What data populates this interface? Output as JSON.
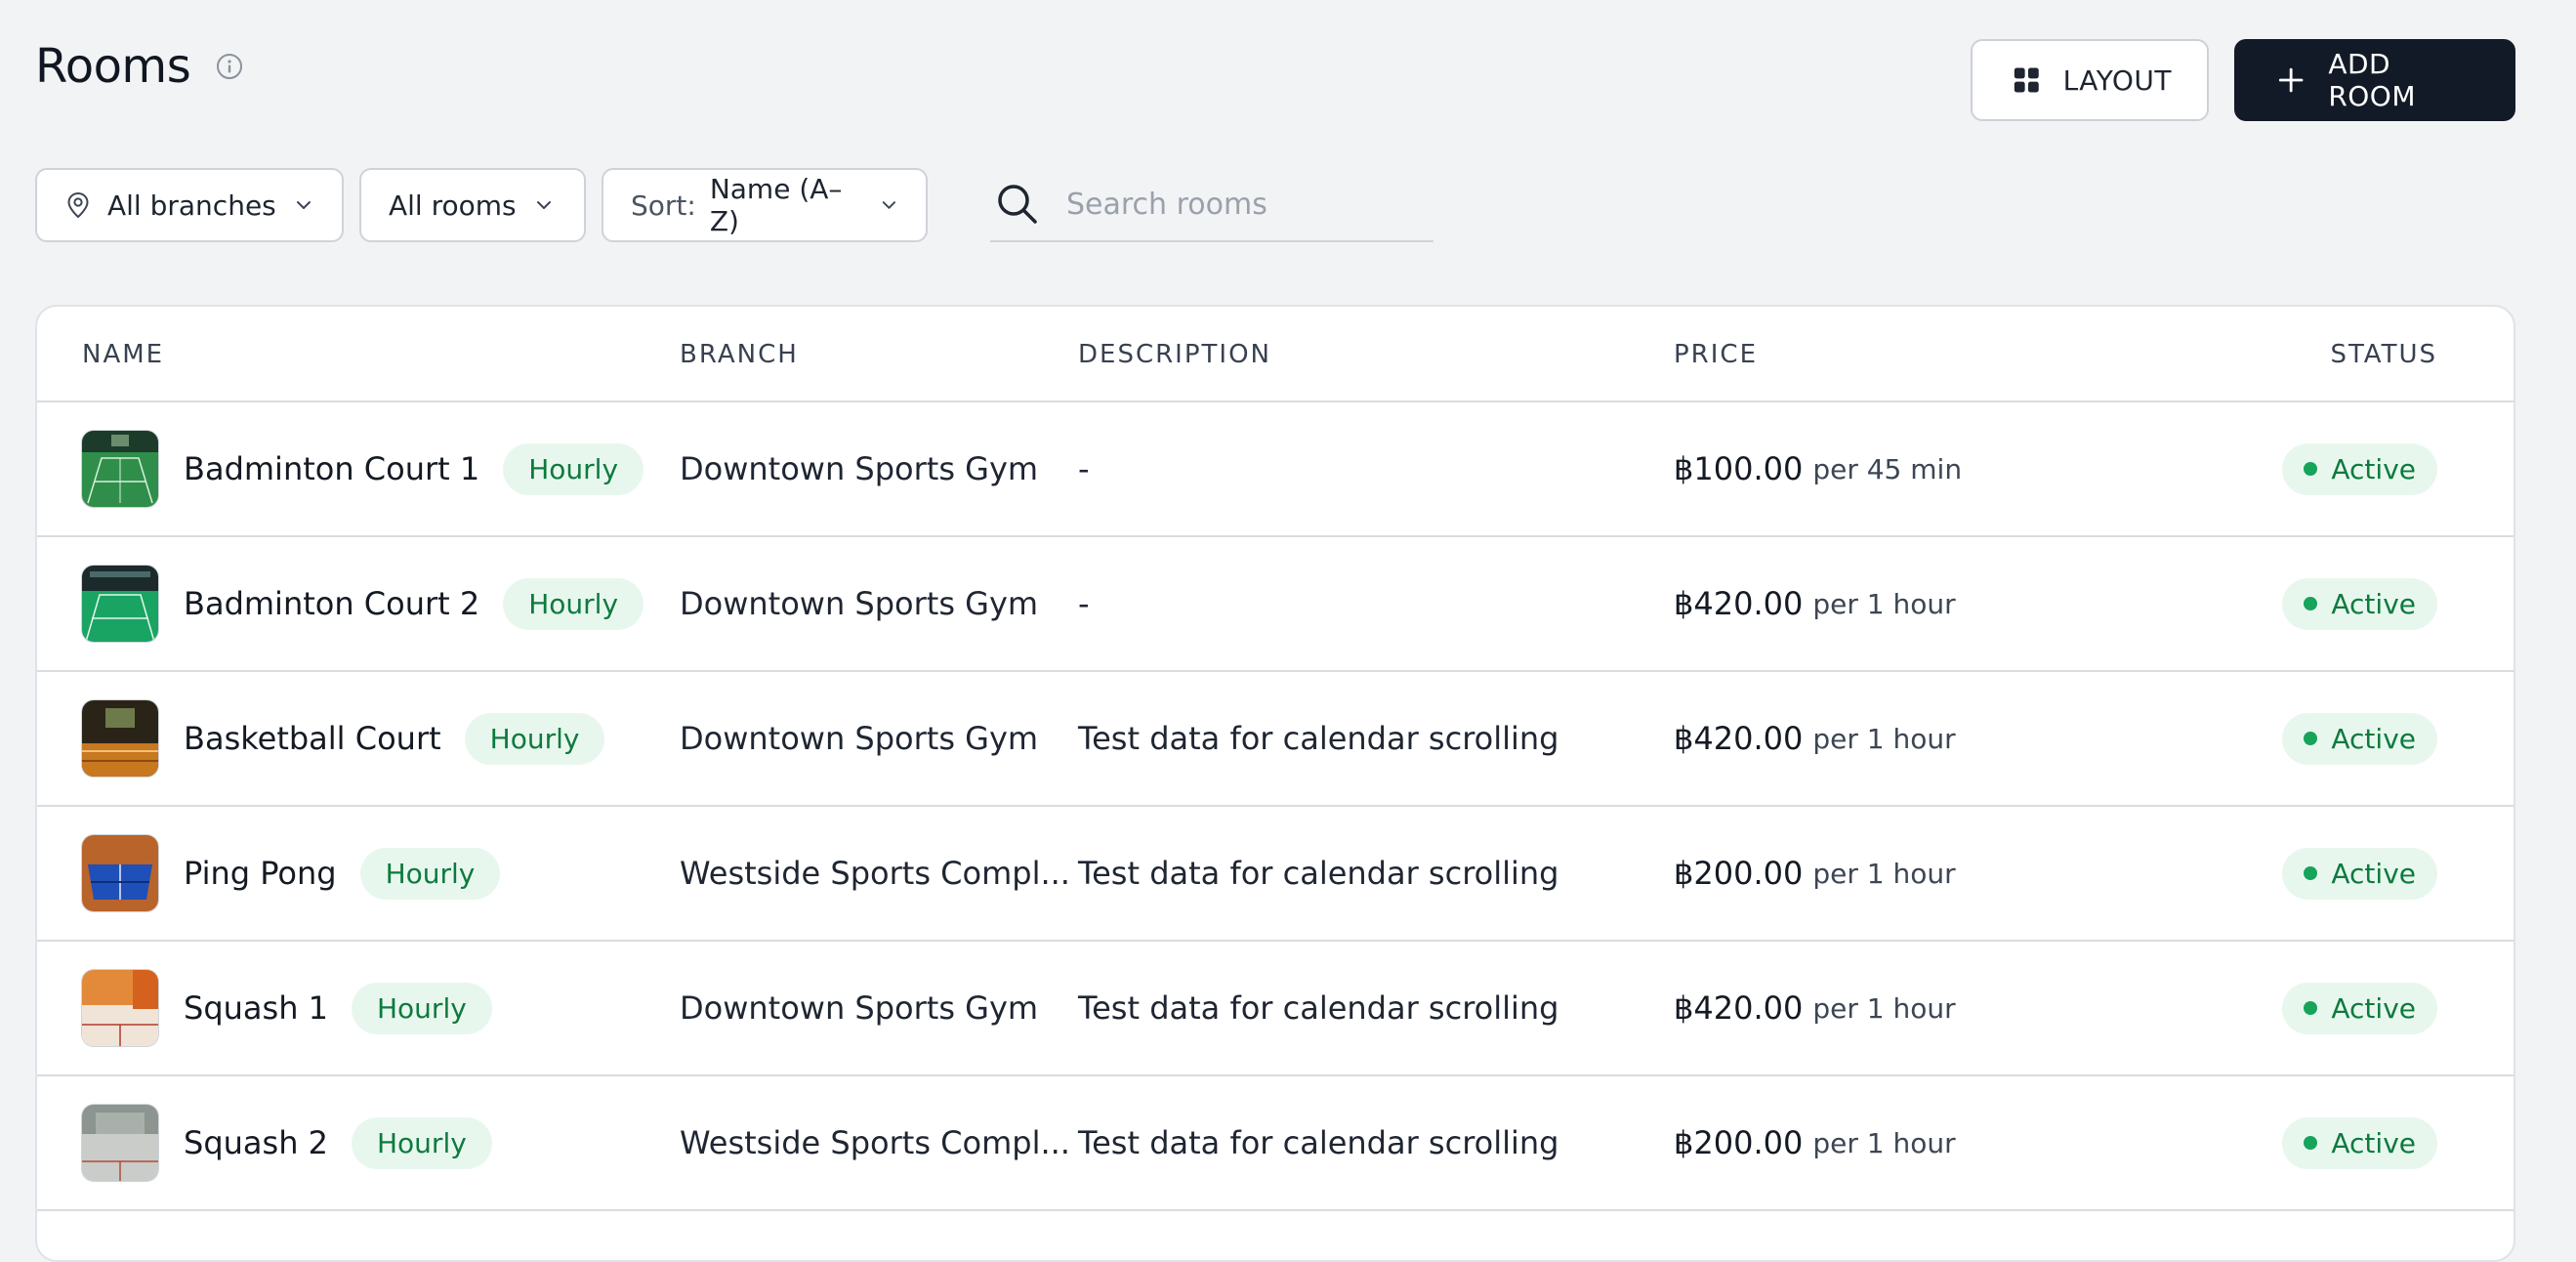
{
  "header": {
    "title": "Rooms",
    "layout_label": "LAYOUT",
    "add_label": "ADD ROOM"
  },
  "filters": {
    "branch": "All branches",
    "rooms": "All rooms",
    "sort_prefix": "Sort:",
    "sort_value": "Name (A–Z)",
    "search_placeholder": "Search rooms"
  },
  "table": {
    "columns": {
      "name": "NAME",
      "branch": "BRANCH",
      "description": "DESCRIPTION",
      "price": "PRICE",
      "status": "STATUS"
    },
    "rows": [
      {
        "name": "Badminton Court 1",
        "type": "Hourly",
        "branch": "Downtown Sports Gym",
        "description": "-",
        "price": "฿100.00",
        "unit": "per 45 min",
        "status": "Active"
      },
      {
        "name": "Badminton Court 2",
        "type": "Hourly",
        "branch": "Downtown Sports Gym",
        "description": "-",
        "price": "฿420.00",
        "unit": "per 1 hour",
        "status": "Active"
      },
      {
        "name": "Basketball Court",
        "type": "Hourly",
        "branch": "Downtown Sports Gym",
        "description": "Test data for calendar scrolling",
        "price": "฿420.00",
        "unit": "per 1 hour",
        "status": "Active"
      },
      {
        "name": "Ping Pong",
        "type": "Hourly",
        "branch": "Westside Sports Compl...",
        "description": "Test data for calendar scrolling",
        "price": "฿200.00",
        "unit": "per 1 hour",
        "status": "Active"
      },
      {
        "name": "Squash 1",
        "type": "Hourly",
        "branch": "Downtown Sports Gym",
        "description": "Test data for calendar scrolling",
        "price": "฿420.00",
        "unit": "per 1 hour",
        "status": "Active"
      },
      {
        "name": "Squash 2",
        "type": "Hourly",
        "branch": "Westside Sports Compl...",
        "description": "Test data for calendar scrolling",
        "price": "฿200.00",
        "unit": "per 1 hour",
        "status": "Active"
      }
    ]
  },
  "icons": {
    "info": "info-icon",
    "layout": "grid-icon",
    "add": "plus-icon",
    "branch": "map-pin-icon",
    "dropdown": "chevron-down-icon",
    "search": "search-icon"
  },
  "colors": {
    "primary": "#131a27",
    "status_active": "#16a35a",
    "badge_bg": "#e8f7ee",
    "badge_text": "#0d7a3e"
  }
}
